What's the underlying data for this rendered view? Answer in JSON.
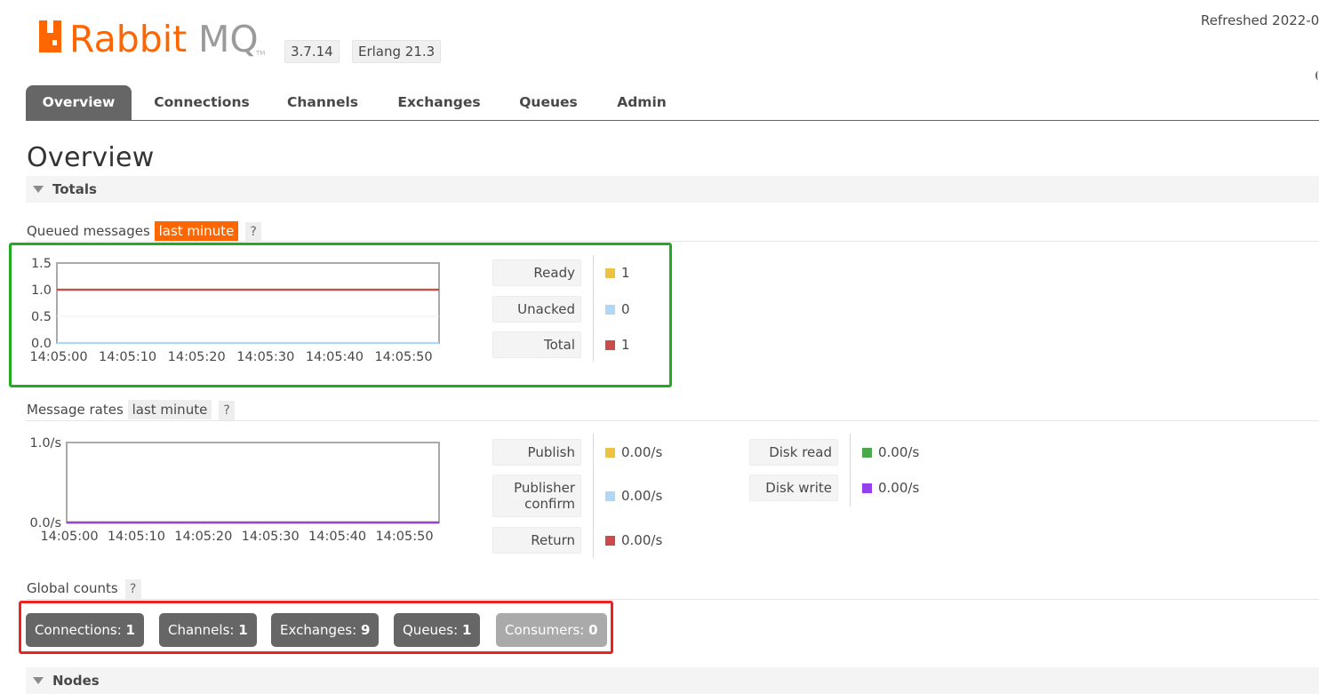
{
  "header": {
    "logo_text": "RabbitMQ",
    "versions": [
      "3.7.14",
      "Erlang 21.3"
    ],
    "refreshed_text": "Refreshed 2022-0"
  },
  "tabs": [
    {
      "label": "Overview",
      "active": true
    },
    {
      "label": "Connections",
      "active": false
    },
    {
      "label": "Channels",
      "active": false
    },
    {
      "label": "Exchanges",
      "active": false
    },
    {
      "label": "Queues",
      "active": false
    },
    {
      "label": "Admin",
      "active": false
    }
  ],
  "page": {
    "title": "Overview",
    "section_totals": "Totals",
    "section_nodes": "Nodes"
  },
  "queued_messages": {
    "label": "Queued messages",
    "range": "last minute",
    "help": "?",
    "legend": [
      {
        "label": "Ready",
        "value": "1",
        "color": "#edc240"
      },
      {
        "label": "Unacked",
        "value": "0",
        "color": "#afd8f8"
      },
      {
        "label": "Total",
        "value": "1",
        "color": "#cb4b4b"
      }
    ]
  },
  "message_rates": {
    "label": "Message rates",
    "range": "last minute",
    "help": "?",
    "legend_left": [
      {
        "label": "Publish",
        "value": "0.00/s",
        "color": "#edc240"
      },
      {
        "label": "Publisher confirm",
        "value": "0.00/s",
        "color": "#afd8f8"
      },
      {
        "label": "Return",
        "value": "0.00/s",
        "color": "#cb4b4b"
      }
    ],
    "legend_right": [
      {
        "label": "Disk read",
        "value": "0.00/s",
        "color": "#4da74d"
      },
      {
        "label": "Disk write",
        "value": "0.00/s",
        "color": "#9440ed"
      }
    ]
  },
  "global_counts": {
    "label": "Global counts",
    "help": "?",
    "items": [
      {
        "label": "Connections:",
        "value": "1"
      },
      {
        "label": "Channels:",
        "value": "1"
      },
      {
        "label": "Exchanges:",
        "value": "9"
      },
      {
        "label": "Queues:",
        "value": "1"
      },
      {
        "label": "Consumers:",
        "value": "0"
      }
    ]
  },
  "chart_data": [
    {
      "type": "line",
      "x": [
        "14:05:00",
        "14:05:10",
        "14:05:20",
        "14:05:30",
        "14:05:40",
        "14:05:50"
      ],
      "ylim": [
        0,
        1.5
      ],
      "yticks": [
        "0.0",
        "0.5",
        "1.0",
        "1.5"
      ],
      "grid": true,
      "series": [
        {
          "name": "Ready",
          "values": [
            1,
            1,
            1,
            1,
            1,
            1
          ],
          "color": "#edc240"
        },
        {
          "name": "Unacked",
          "values": [
            0,
            0,
            0,
            0,
            0,
            0
          ],
          "color": "#afd8f8"
        },
        {
          "name": "Total",
          "values": [
            1,
            1,
            1,
            1,
            1,
            1
          ],
          "color": "#cb4b4b"
        }
      ]
    },
    {
      "type": "line",
      "x": [
        "14:05:00",
        "14:05:10",
        "14:05:20",
        "14:05:30",
        "14:05:40",
        "14:05:50"
      ],
      "ylim": [
        0,
        1
      ],
      "yticks": [
        "0.0/s",
        "1.0/s"
      ],
      "grid": true,
      "series": [
        {
          "name": "Publish",
          "values": [
            0,
            0,
            0,
            0,
            0,
            0
          ],
          "color": "#edc240"
        },
        {
          "name": "Publisher confirm",
          "values": [
            0,
            0,
            0,
            0,
            0,
            0
          ],
          "color": "#afd8f8"
        },
        {
          "name": "Return",
          "values": [
            0,
            0,
            0,
            0,
            0,
            0
          ],
          "color": "#cb4b4b"
        },
        {
          "name": "Disk read",
          "values": [
            0,
            0,
            0,
            0,
            0,
            0
          ],
          "color": "#4da74d"
        },
        {
          "name": "Disk write",
          "values": [
            0,
            0,
            0,
            0,
            0,
            0
          ],
          "color": "#9440ed"
        }
      ]
    }
  ]
}
